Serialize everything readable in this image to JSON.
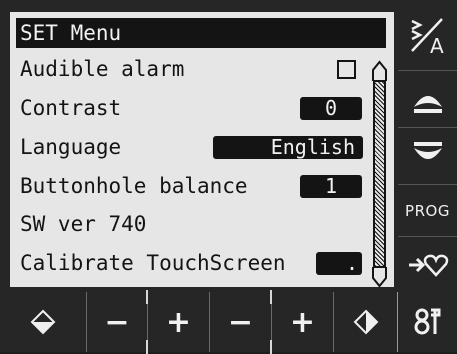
{
  "menu": {
    "title": "SET Menu",
    "items": [
      {
        "label": "Audible alarm",
        "control": "checkbox",
        "checked": false
      },
      {
        "label": "Contrast",
        "control": "value",
        "value": "0"
      },
      {
        "label": "Language",
        "control": "value",
        "value": "English"
      },
      {
        "label": "Buttonhole balance",
        "control": "value",
        "value": "1"
      },
      {
        "label": "SW ver 740",
        "control": "none"
      },
      {
        "label": "Calibrate TouchScreen",
        "control": "button",
        "value": "."
      }
    ]
  },
  "side_buttons": {
    "text_edit_icon": "text-edit-icon",
    "scroll_up_icon": "scroll-up-icon",
    "scroll_down_icon": "scroll-down-icon",
    "prog_label": "PROG",
    "to_favorites_icon": "arrow-heart-icon"
  },
  "bottom_buttons": {
    "left_icon": "diamond-down-icon",
    "minus_1": "−",
    "plus_1": "+",
    "minus_2": "−",
    "plus_2": "+",
    "right_icon": "diamond-right-icon",
    "tools_icon": "tools-icon"
  },
  "colors": {
    "lcd_bg": "#e6e6e6",
    "ink": "#141414",
    "panel": "#262626"
  }
}
